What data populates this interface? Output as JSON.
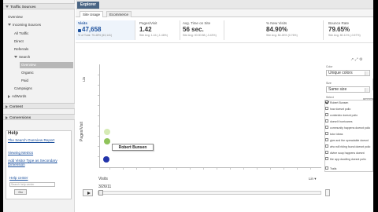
{
  "sidebar": {
    "traffic_sources": "Traffic Sources",
    "overview": "Overview",
    "incoming_sources": "Incoming Sources",
    "all_traffic": "All Traffic",
    "direct": "Direct",
    "referrals": "Referrals",
    "search": "Search",
    "search_overview": "Overview",
    "organic": "Organic",
    "paid": "Paid",
    "campaigns": "Campaigns",
    "adwords": "AdWords",
    "content": "Content",
    "conversions": "Conversions",
    "help_title": "Help",
    "help_links": [
      "The Search Overview Report",
      "Viewing Metrics",
      "Add Visitor Type as Secondary Dimension"
    ],
    "help_center": "Help center",
    "search_placeholder": "Search help center",
    "go_button": "Go"
  },
  "header": {
    "tab_active": "Explorer",
    "subtab_site_usage": "Site Usage",
    "subtab_ecommerce": "Ecommerce"
  },
  "metrics": [
    {
      "label": "Visits",
      "value": "47,658",
      "sub": "% of Total: 75.48% (63,141)"
    },
    {
      "label": "Pages/Visit",
      "value": "1.42",
      "sub": "Site Avg: 1.44 (-1.46%)"
    },
    {
      "label": "Avg. Time on Site",
      "value": "56 sec.",
      "sub": "Site Avg: 00:00:58 (-3.43%)"
    },
    {
      "label": "% New Visits",
      "value": "84.90%",
      "sub": "Site Avg: 84.26% (0.76%)"
    },
    {
      "label": "Bounce Rate",
      "value": "79.65%",
      "sub": "Site Avg: 80.11% (-0.57%)"
    }
  ],
  "chart": {
    "y_axis_select": "Lin",
    "y_axis_title": "Pages/Visit",
    "x_axis_title": "Visits",
    "x_axis_select": "Lin",
    "tooltip": "Robert Bunsen",
    "date": "3/26/11"
  },
  "chart_data": {
    "type": "scatter",
    "xlabel": "Visits",
    "ylabel": "Pages/Visit",
    "points": [
      {
        "label": "Robert Bunsen",
        "color": "#2233aa",
        "selected": true
      },
      {
        "label": "",
        "color": "#8fc35a"
      },
      {
        "label": "",
        "color": "#d6ebb5"
      }
    ]
  },
  "right_panel": {
    "color_label": "Color",
    "color_value": "Unique colors",
    "size_label": "Size",
    "size_value": "Same size",
    "select_label": "Select",
    "deselect_button": "Deselect all",
    "items": [
      {
        "label": "Robert Bunsen",
        "checked": true
      },
      {
        "label": "how doesnt polio",
        "checked": false
      },
      {
        "label": "contenido doesnt polio",
        "checked": false
      },
      {
        "label": "doesn't hurricanes",
        "checked": false
      },
      {
        "label": "community happens doesnt polio",
        "checked": false
      },
      {
        "label": "tutor ideas",
        "checked": false
      },
      {
        "label": "give and the spreadable doesnt",
        "checked": false
      },
      {
        "label": "who will riding found doesnt polio",
        "checked": false
      },
      {
        "label": "divine soup happens doesnt",
        "checked": false
      },
      {
        "label": "the app doodling doesnt polio",
        "checked": false
      }
    ],
    "trails_label": "Trails"
  },
  "colors": {
    "selected_point": "#2233aa",
    "point_2": "#8fc35a",
    "point_3": "#d6ebb5",
    "tab_active_bg": "#4a6584",
    "link": "#1a4f9c"
  }
}
